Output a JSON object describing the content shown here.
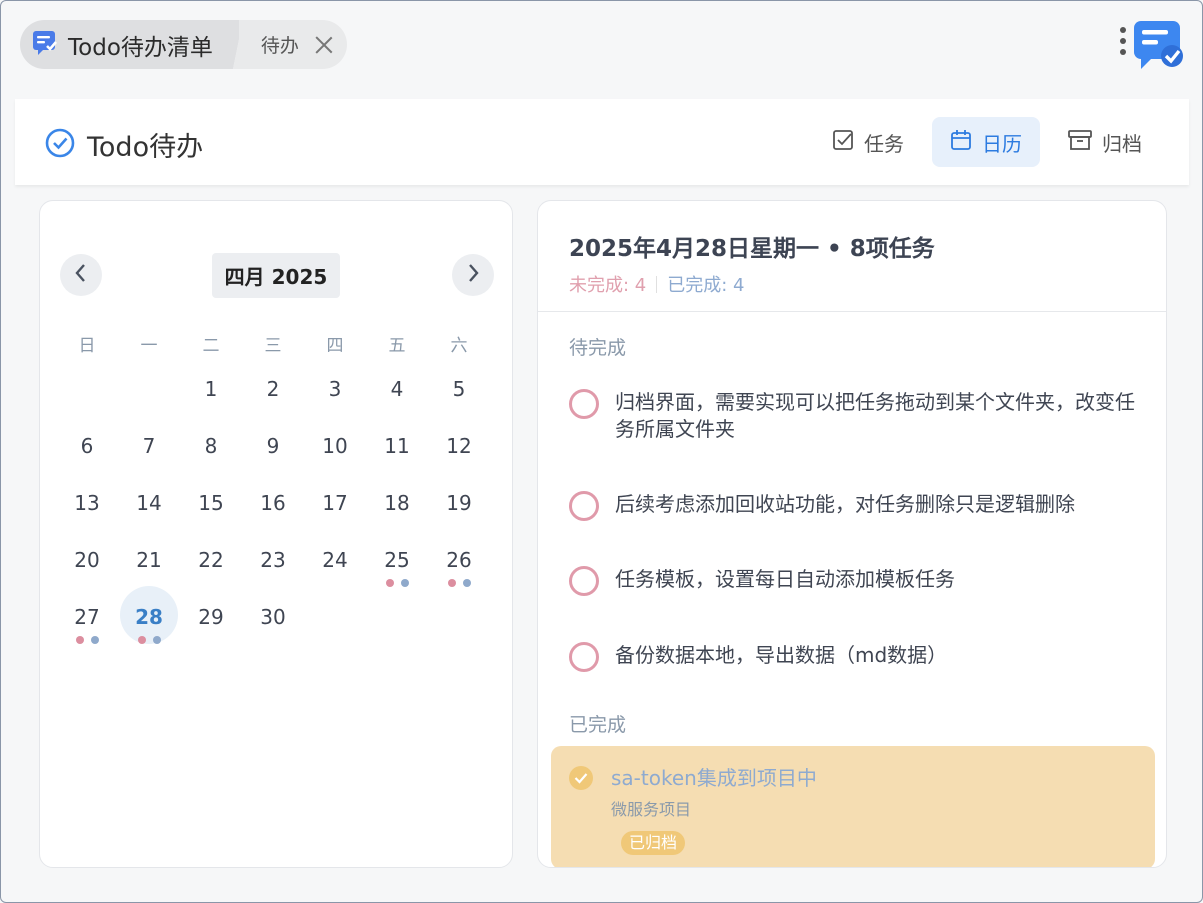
{
  "breadcrumb": {
    "main": "Todo待办清单",
    "sub": "待办"
  },
  "header": {
    "title": "Todo待办",
    "tabs": [
      {
        "label": "任务",
        "icon": "checkbox-icon",
        "active": false
      },
      {
        "label": "日历",
        "icon": "calendar-icon",
        "active": true
      },
      {
        "label": "归档",
        "icon": "archive-icon",
        "active": false
      }
    ]
  },
  "calendar": {
    "month_label": "四月 2025",
    "weekdays": [
      "日",
      "一",
      "二",
      "三",
      "四",
      "五",
      "六"
    ],
    "first_weekday": 2,
    "days_in_month": 30,
    "selected_day": 28,
    "days_with_dots": [
      25,
      26,
      27,
      28
    ]
  },
  "tasks": {
    "date_title": "2025年4月28日星期一 • 8项任务",
    "undone_label": "未完成: 4",
    "done_label": "已完成: 4",
    "pending_section": "待完成",
    "pending": [
      "归档界面，需要实现可以把任务拖动到某个文件夹，改变任务所属文件夹",
      "后续考虑添加回收站功能，对任务删除只是逻辑删除",
      "任务模板，设置每日自动添加模板任务",
      "备份数据本地，导出数据（md数据）"
    ],
    "done_section": "已完成",
    "done": [
      {
        "name": "sa-token集成到项目中",
        "folder": "微服务项目",
        "badge": "已归档"
      }
    ]
  },
  "colors": {
    "accent": "#2c7be0",
    "pending_ring": "#e09aaa",
    "dot_pink": "#dc8e9f",
    "dot_blue": "#8fa9cb",
    "done_bg": "#f5ddb2"
  }
}
